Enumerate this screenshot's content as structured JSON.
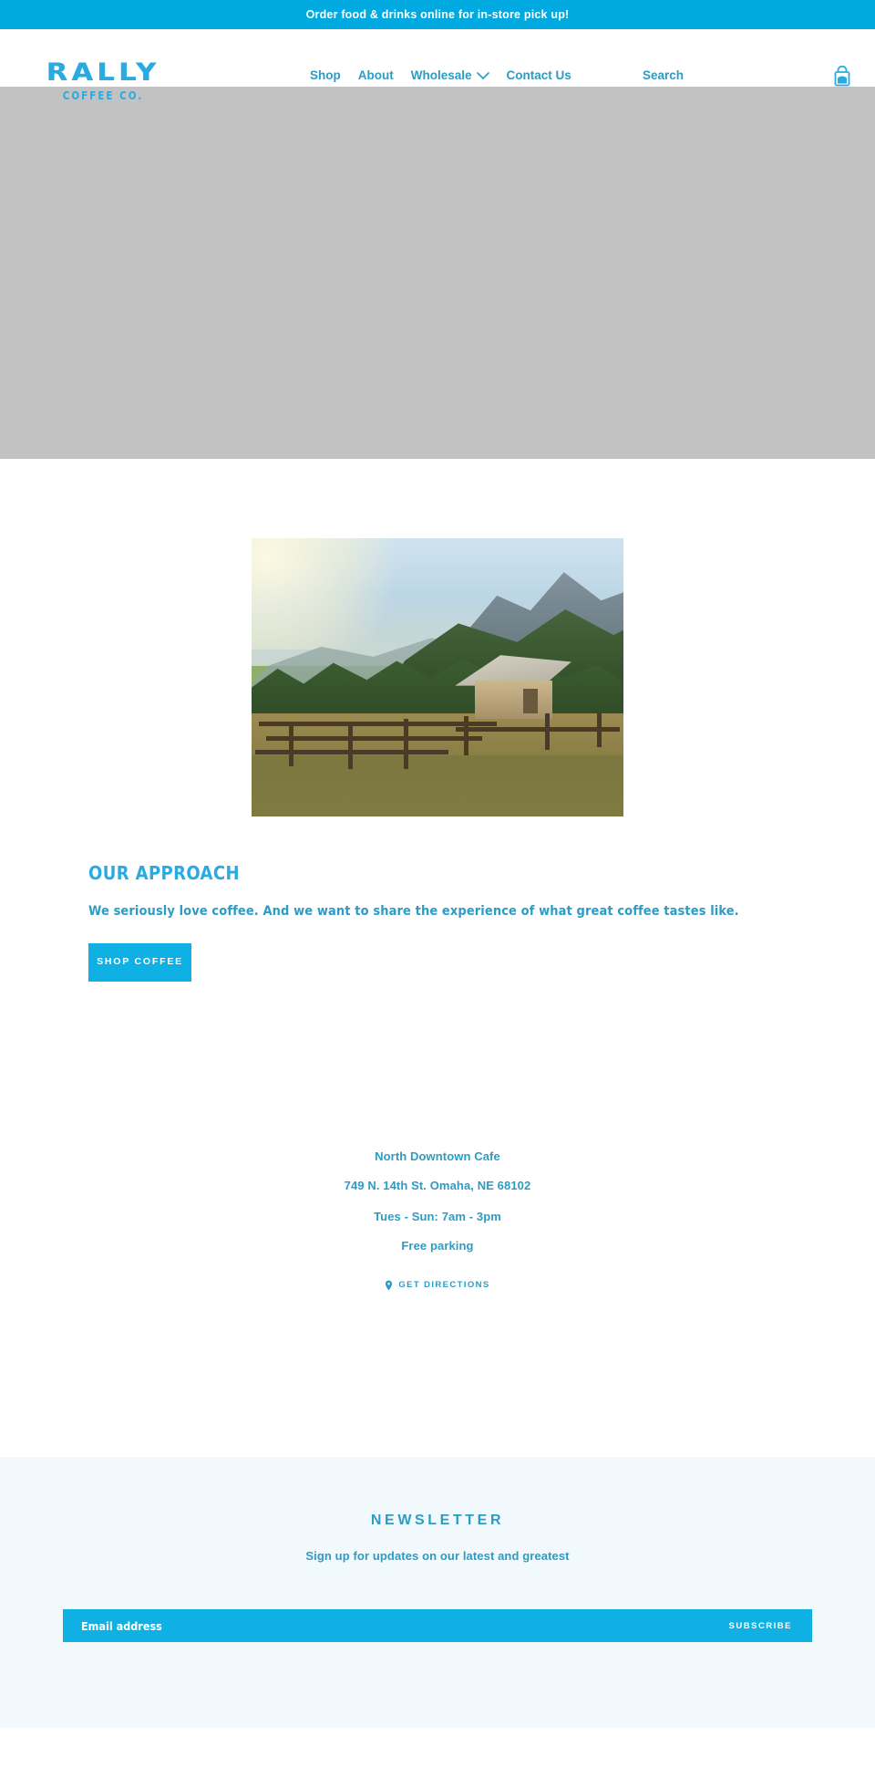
{
  "announcement": {
    "text": "Order food & drinks online for in-store pick up!",
    "background": "#00a9e0"
  },
  "header": {
    "logo": {
      "primary": "RALLY",
      "secondary": "COFFEE CO.",
      "color": "#29abe2"
    },
    "nav": [
      {
        "label": "Shop",
        "has_dropdown": false
      },
      {
        "label": "About",
        "has_dropdown": false
      },
      {
        "label": "Wholesale",
        "has_dropdown": true
      },
      {
        "label": "Contact Us",
        "has_dropdown": false
      }
    ],
    "search_label": "Search",
    "cart_icon": "shopping-bag-icon",
    "nav_color": "#2d9cc4"
  },
  "hero": {
    "placeholder_color": "#c2c2c2"
  },
  "approach": {
    "image_alt": "coffee-farm-hillside-photo",
    "title": "OUR APPROACH",
    "subtitle": "We seriously love coffee. And we want to share the experience of what great coffee tastes like.",
    "button_label": "SHOP COFFEE",
    "button_color": "#0fb0e3",
    "title_color": "#29abe2"
  },
  "cafe": {
    "name": "North Downtown Cafe",
    "address": "749 N. 14th St. Omaha, NE 68102",
    "hours": "Tues - Sun: 7am - 3pm",
    "parking": "Free parking",
    "directions_label": "GET DIRECTIONS",
    "directions_icon": "map-pin-icon",
    "text_color": "#2d9cc4"
  },
  "newsletter": {
    "title": "NEWSLETTER",
    "subtitle": "Sign up for updates on our latest and greatest",
    "email_placeholder": "Email address",
    "email_value": "",
    "submit_label": "SUBSCRIBE",
    "background": "#f1f9fd",
    "form_color": "#0fb0e3"
  }
}
